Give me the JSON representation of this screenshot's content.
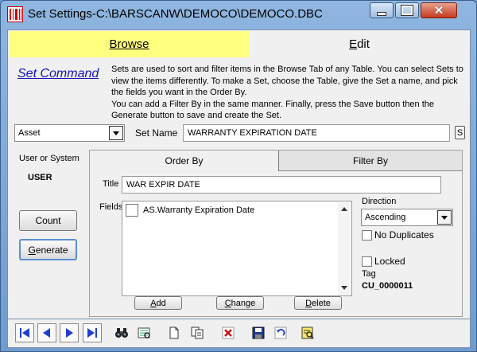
{
  "window": {
    "title": "Set Settings-C:\\BARSCANW\\DEMOCO\\DEMOCO.DBC",
    "close_glyph": "✕"
  },
  "tabs": {
    "browse": "Browse",
    "edit_underlined": "E",
    "edit_rest": "dit"
  },
  "set_command": "Set Command",
  "help_text": [
    "Sets are used to sort and filter items in the Browse Tab of any Table.  You can select Sets to view the items differently.  To make a Set, choose the Table, give the Set a name, and pick the fields you want in the Order By.",
    "You can add a Filter By in the same manner.  Finally, press the Save button then the Generate button to save and create the Set."
  ],
  "table_select": {
    "value": "Asset"
  },
  "set_name": {
    "label": "Set Name",
    "value": "WARRANTY EXPIRATION DATE",
    "s_button": "S"
  },
  "user_or_system": {
    "label": "User or System",
    "value": "USER"
  },
  "buttons": {
    "count": "Count",
    "generate_underlined": "G",
    "generate_rest": "enerate",
    "add_underlined": "A",
    "add_rest": "dd",
    "change_underlined": "C",
    "change_rest": "hange",
    "delete_underlined": "D",
    "delete_rest": "elete"
  },
  "subtabs": {
    "order_by": "Order By",
    "filter_by": "Filter By"
  },
  "order_by": {
    "title_label": "Title",
    "title_value": "WAR EXPIR DATE",
    "fields_label": "Fields",
    "fields": [
      {
        "label": "AS.Warranty Expiration Date",
        "checked": false
      }
    ],
    "direction_label": "Direction",
    "direction_value": "Ascending",
    "no_duplicates": "No Duplicates",
    "locked": "Locked",
    "tag_label": "Tag",
    "tag_value": "CU_0000011"
  },
  "toolbar_icons": [
    "first-record-icon",
    "previous-record-icon",
    "next-record-icon",
    "last-record-icon",
    "binoculars-find-icon",
    "list-view-icon",
    "new-document-icon",
    "copy-icon",
    "delete-x-icon",
    "save-icon",
    "undo-icon",
    "report-icon"
  ],
  "colors": {
    "browse_tab": "#ffff80",
    "link": "#1515b8",
    "toolbar_blue": "#1f3fd0",
    "delete_red": "#cc1010"
  }
}
